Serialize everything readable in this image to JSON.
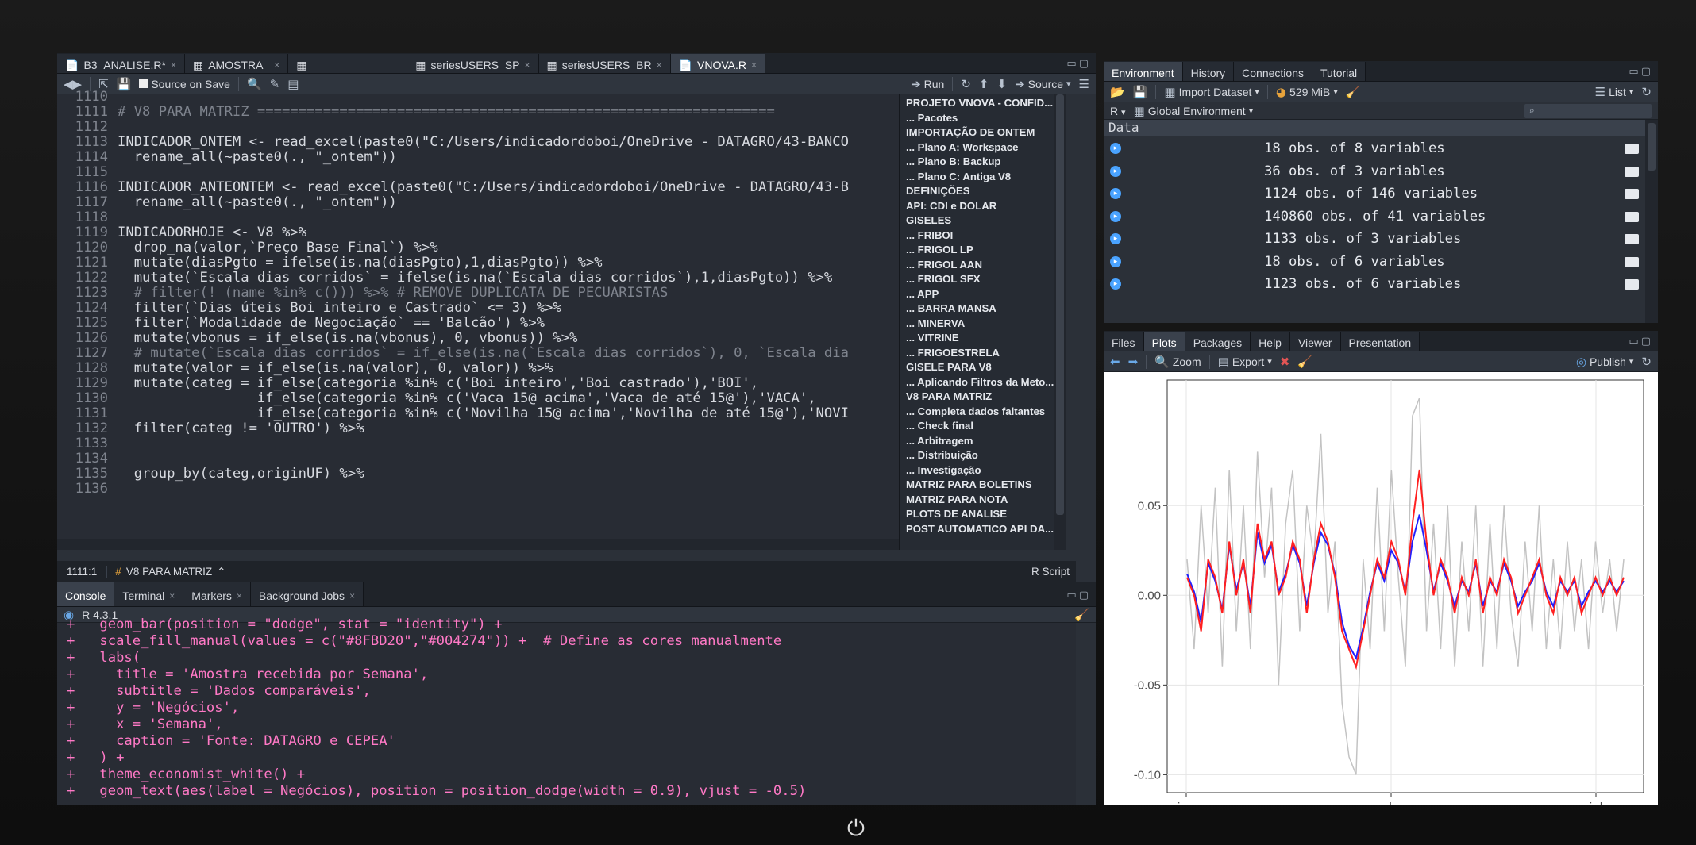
{
  "editor": {
    "tabs": [
      {
        "label": "B3_ANALISE.R*",
        "active": false
      },
      {
        "label": "AMOSTRA_",
        "active": false
      },
      {
        "label": "",
        "active": false
      },
      {
        "label": "seriesUSERS_SP",
        "active": false
      },
      {
        "label": "seriesUSERS_BR",
        "active": false
      },
      {
        "label": "VNOVA.R",
        "active": true
      }
    ],
    "toolbar": {
      "source_on_save": "Source on Save",
      "run_label": "Run",
      "source_label": "Source"
    },
    "lines": [
      {
        "n": "1110",
        "t": ""
      },
      {
        "n": "1111",
        "t": "# V8 PARA MATRIZ ==============================================================="
      },
      {
        "n": "1112",
        "t": ""
      },
      {
        "n": "1113",
        "t": "INDICADOR_ONTEM <- read_excel(paste0(\"C:/Users/indicadordoboi/OneDrive - DATAGRO/43-BANCO"
      },
      {
        "n": "1114",
        "t": "  rename_all(~paste0(., \"_ontem\"))"
      },
      {
        "n": "1115",
        "t": ""
      },
      {
        "n": "1116",
        "t": "INDICADOR_ANTEONTEM <- read_excel(paste0(\"C:/Users/indicadordoboi/OneDrive - DATAGRO/43-B"
      },
      {
        "n": "1117",
        "t": "  rename_all(~paste0(., \"_ontem\"))"
      },
      {
        "n": "1118",
        "t": ""
      },
      {
        "n": "1119",
        "t": "INDICADORHOJE <- V8 %>%"
      },
      {
        "n": "1120",
        "t": "  drop_na(valor,`Preço Base Final`) %>%"
      },
      {
        "n": "1121",
        "t": "  mutate(diasPgto = ifelse(is.na(diasPgto),1,diasPgto)) %>%"
      },
      {
        "n": "1122",
        "t": "  mutate(`Escala dias corridos` = ifelse(is.na(`Escala dias corridos`),1,diasPgto)) %>%"
      },
      {
        "n": "1123",
        "t": "  # filter(! (name %in% c())) %>% # REMOVE DUPLICATA DE PECUARISTAS"
      },
      {
        "n": "1124",
        "t": "  filter(`Dias úteis Boi inteiro e Castrado` <= 3) %>%"
      },
      {
        "n": "1125",
        "t": "  filter(`Modalidade de Negociação` == 'Balcão') %>%"
      },
      {
        "n": "1126",
        "t": "  mutate(vbonus = if_else(is.na(vbonus), 0, vbonus)) %>%"
      },
      {
        "n": "1127",
        "t": "  # mutate(`Escala dias corridos` = if_else(is.na(`Escala dias corridos`), 0, `Escala dia"
      },
      {
        "n": "1128",
        "t": "  mutate(valor = if_else(is.na(valor), 0, valor)) %>%"
      },
      {
        "n": "1129",
        "t": "  mutate(categ = if_else(categoria %in% c('Boi inteiro','Boi castrado'),'BOI',"
      },
      {
        "n": "1130",
        "t": "                 if_else(categoria %in% c('Vaca 15@ acima','Vaca de até 15@'),'VACA',"
      },
      {
        "n": "1131",
        "t": "                 if_else(categoria %in% c('Novilha 15@ acima','Novilha de até 15@'),'NOVI"
      },
      {
        "n": "1132",
        "t": "  filter(categ != 'OUTRO') %>%"
      },
      {
        "n": "1133",
        "t": ""
      },
      {
        "n": "1134",
        "t": ""
      },
      {
        "n": "1135",
        "t": "  group_by(categ,originUF) %>%"
      },
      {
        "n": "1136",
        "t": ""
      }
    ],
    "outline": [
      "PROJETO VNOVA - CONFID...",
      "... Pacotes",
      "IMPORTAÇÃO DE ONTEM",
      "... Plano A: Workspace",
      "... Plano B: Backup",
      "... Plano C: Antiga V8",
      "DEFINIÇÕES",
      "API: CDI e DOLAR",
      "GISELES",
      "... FRIBOI",
      "... FRIGOL LP",
      "... FRIGOL AAN",
      "... FRIGOL SFX",
      "... APP",
      "... BARRA MANSA",
      "... MINERVA",
      "... VITRINE",
      "... FRIGOESTRELA",
      "GISELE PARA V8",
      "... Aplicando Filtros da Meto...",
      "V8 PARA MATRIZ",
      "... Completa dados faltantes",
      "... Check final",
      "... Arbitragem",
      "... Distribuição",
      "... Investigação",
      "MATRIZ PARA BOLETINS",
      "MATRIZ PARA NOTA",
      "PLOTS DE ANALISE",
      "POST AUTOMATICO API DA..."
    ],
    "status": {
      "position": "1111:1",
      "section": "V8 PARA MATRIZ",
      "file_type": "R Script"
    }
  },
  "console": {
    "tabs": [
      "Console",
      "Terminal",
      "Markers",
      "Background Jobs"
    ],
    "r_version": "R 4.3.1",
    "lines": [
      "+   geom_bar(position = \"dodge\", stat = \"identity\") +",
      "+   scale_fill_manual(values = c(\"#8FBD20\",\"#004274\")) +  # Define as cores manualmente",
      "+   labs(",
      "+     title = 'Amostra recebida por Semana',",
      "+     subtitle = 'Dados comparáveis',",
      "+     y = 'Negócios',",
      "+     x = 'Semana',",
      "+     caption = 'Fonte: DATAGRO e CEPEA'",
      "+   ) +",
      "+   theme_economist_white() +",
      "+   geom_text(aes(label = Negócios), position = position_dodge(width = 0.9), vjust = -0.5)"
    ]
  },
  "environment": {
    "tabs": [
      "Environment",
      "History",
      "Connections",
      "Tutorial"
    ],
    "import_label": "Import Dataset",
    "memory": "529 MiB",
    "view_mode": "List",
    "r_label": "R",
    "scope": "Global Environment",
    "section": "Data",
    "rows": [
      "18 obs. of 8 variables",
      "36 obs. of 3 variables",
      "1124 obs. of 146 variables",
      "140860 obs. of 41 variables",
      "1133 obs. of 3 variables",
      "18 obs. of 6 variables",
      "1123 obs. of 6 variables"
    ]
  },
  "plots": {
    "tabs": [
      "Files",
      "Plots",
      "Packages",
      "Help",
      "Viewer",
      "Presentation"
    ],
    "zoom_label": "Zoom",
    "export_label": "Export",
    "publish_label": "Publish",
    "colors": {
      "red": "#ff2020",
      "blue": "#2020ff",
      "gray": "#bdbdbd"
    },
    "chart_data": {
      "type": "line",
      "yticks": [
        "0.05",
        "0.00",
        "-0.05",
        "-0.10"
      ],
      "xticks": [
        "jan",
        "abr",
        "jul"
      ],
      "ylim": [
        -0.11,
        0.12
      ],
      "grid": true,
      "series": [
        {
          "color": "red",
          "values": [
            0.01,
            0.0,
            -0.02,
            0.02,
            0.01,
            -0.01,
            0.03,
            0.0,
            0.02,
            -0.01,
            0.04,
            0.02,
            0.03,
            0.0,
            0.01,
            0.03,
            0.02,
            -0.01,
            0.02,
            0.04,
            0.03,
            0.01,
            -0.02,
            -0.03,
            -0.04,
            -0.02,
            0.0,
            0.02,
            0.01,
            0.03,
            0.02,
            0.0,
            0.04,
            0.07,
            0.03,
            0.0,
            0.02,
            0.01,
            -0.01,
            0.01,
            0.0,
            0.02,
            -0.01,
            0.01,
            0.0,
            0.02,
            0.01,
            -0.01,
            0.0,
            0.01,
            0.02,
            0.0,
            -0.01,
            0.01,
            0.0,
            0.01,
            -0.01,
            0.0,
            0.01,
            0.0,
            0.01,
            0.0,
            0.01
          ]
        },
        {
          "color": "blue",
          "values": [
            0.012,
            0.002,
            -0.015,
            0.018,
            0.008,
            -0.008,
            0.028,
            0.003,
            0.018,
            -0.006,
            0.035,
            0.018,
            0.028,
            0.002,
            0.012,
            0.028,
            0.018,
            -0.006,
            0.018,
            0.035,
            0.028,
            0.012,
            -0.015,
            -0.028,
            -0.035,
            -0.018,
            0.002,
            0.018,
            0.008,
            0.025,
            0.018,
            0.002,
            0.03,
            0.045,
            0.025,
            0.002,
            0.018,
            0.008,
            -0.006,
            0.008,
            0.002,
            0.018,
            -0.006,
            0.008,
            0.002,
            0.018,
            0.008,
            -0.006,
            0.002,
            0.008,
            0.018,
            0.002,
            -0.006,
            0.008,
            0.002,
            0.008,
            -0.006,
            0.002,
            0.008,
            0.002,
            0.008,
            0.002,
            0.008
          ]
        },
        {
          "color": "gray",
          "values": [
            0.02,
            -0.03,
            0.05,
            -0.01,
            0.06,
            -0.04,
            0.07,
            -0.02,
            0.05,
            -0.03,
            0.08,
            0.01,
            0.06,
            -0.05,
            0.04,
            0.07,
            -0.02,
            0.05,
            0.02,
            0.09,
            -0.01,
            0.03,
            -0.06,
            -0.09,
            -0.1,
            0.02,
            -0.03,
            0.06,
            -0.02,
            0.07,
            0.01,
            -0.04,
            0.1,
            0.11,
            -0.02,
            0.04,
            -0.03,
            0.05,
            -0.04,
            0.03,
            -0.02,
            0.05,
            -0.04,
            0.04,
            -0.03,
            0.05,
            -0.01,
            -0.04,
            0.03,
            -0.02,
            0.05,
            -0.03,
            0.02,
            -0.03,
            0.03,
            -0.02,
            0.02,
            -0.03,
            0.03,
            -0.01,
            0.02,
            -0.02,
            0.02
          ]
        }
      ]
    }
  }
}
